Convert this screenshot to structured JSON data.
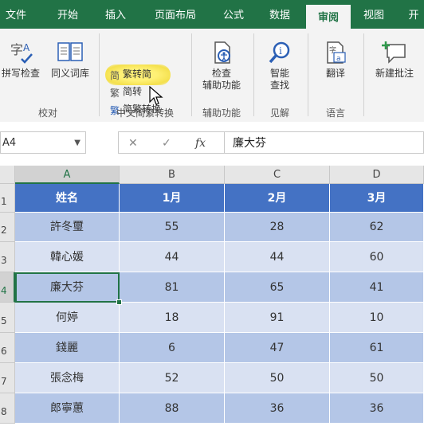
{
  "tabs": [
    {
      "label": "文件",
      "active": false
    },
    {
      "label": "开始",
      "active": false
    },
    {
      "label": "插入",
      "active": false
    },
    {
      "label": "页面布局",
      "active": false
    },
    {
      "label": "公式",
      "active": false
    },
    {
      "label": "数据",
      "active": false
    },
    {
      "label": "审阅",
      "active": true
    },
    {
      "label": "视图",
      "active": false
    },
    {
      "label": "开",
      "active": false
    }
  ],
  "ribbon": {
    "proofing": {
      "spell_label": "拼写检查",
      "thesaurus_label": "同义词库",
      "group_label": "校对"
    },
    "chinese_conversion": {
      "trad_to_simp_label": "繁转简",
      "simp_to_trad_label": "简转",
      "convert_label": "简繁转换",
      "group_label": "中文简繁转换"
    },
    "accessibility": {
      "check_label_1": "检查",
      "check_label_2": "辅助功能",
      "group_label": "辅助功能"
    },
    "insights": {
      "smart_label_1": "智能",
      "smart_label_2": "查找",
      "group_label": "见解"
    },
    "language": {
      "translate_label": "翻译",
      "group_label": "语言"
    },
    "comments": {
      "new_comment_label": "新建批注"
    }
  },
  "formula_bar": {
    "name_box": "A4",
    "formula_value": "廉大芬"
  },
  "columns": [
    "A",
    "B",
    "C",
    "D"
  ],
  "row_numbers": [
    "1",
    "2",
    "3",
    "4",
    "5",
    "6",
    "7",
    "8"
  ],
  "table": {
    "headers": [
      "姓名",
      "1月",
      "2月",
      "3月"
    ],
    "rows": [
      [
        "許冬璽",
        "55",
        "28",
        "62"
      ],
      [
        "韓心媛",
        "44",
        "44",
        "60"
      ],
      [
        "廉大芬",
        "81",
        "65",
        "41"
      ],
      [
        "何婷",
        "18",
        "91",
        "10"
      ],
      [
        "錢麗",
        "6",
        "47",
        "61"
      ],
      [
        "張念梅",
        "52",
        "50",
        "50"
      ],
      [
        "郎寧蕙",
        "88",
        "36",
        "36"
      ]
    ]
  },
  "colors": {
    "excel_green": "#217346",
    "table_header": "#4472c4",
    "band_dark": "#b4c6e7",
    "band_light": "#d9e1f2",
    "highlight": "#fff176"
  }
}
